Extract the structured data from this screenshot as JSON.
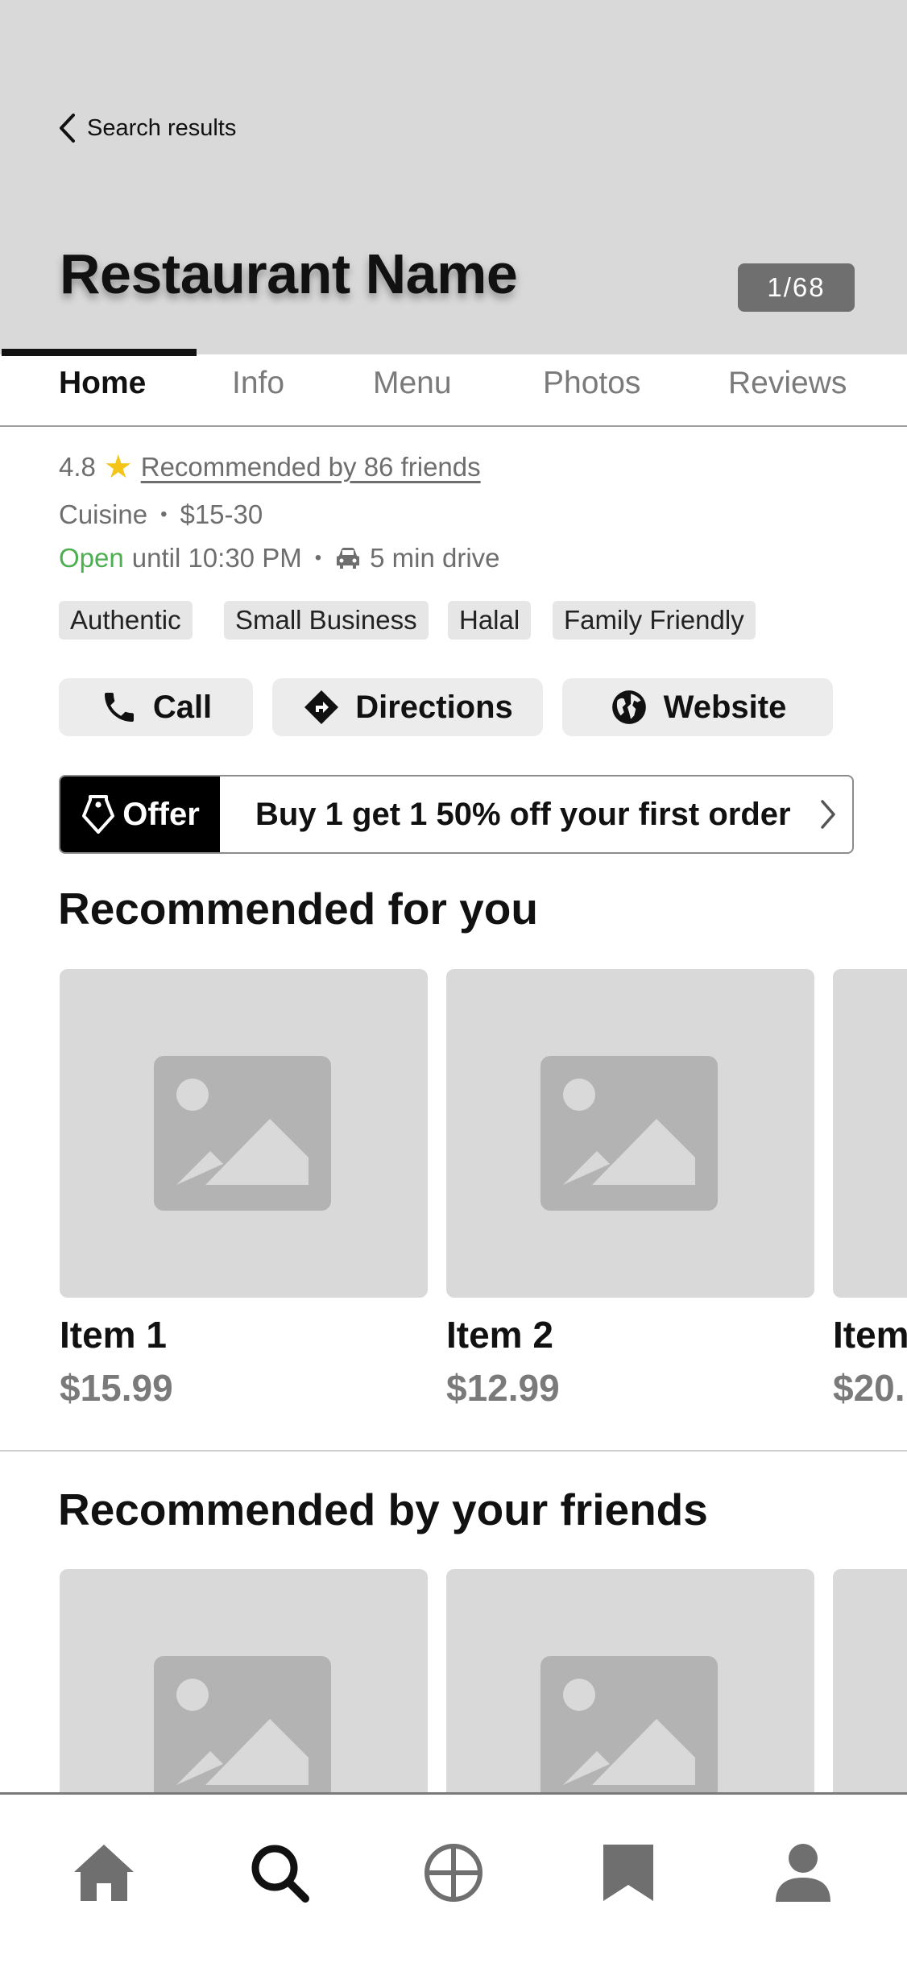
{
  "header": {
    "back_label": "Search results",
    "title": "Restaurant Name",
    "photo_counter": "1/68"
  },
  "tabs": [
    {
      "label": "Home",
      "active": true
    },
    {
      "label": "Info",
      "active": false
    },
    {
      "label": "Menu",
      "active": false
    },
    {
      "label": "Photos",
      "active": false
    },
    {
      "label": "Reviews",
      "active": false
    }
  ],
  "summary": {
    "rating": "4.8",
    "friends_text": "Recommended by 86 friends",
    "cuisine": "Cuisine",
    "price_range": "$15-30",
    "open_status": "Open",
    "hours": "until 10:30 PM",
    "drive_time": "5 min drive"
  },
  "tags": [
    "Authentic",
    "Small Business",
    "Halal",
    "Family Friendly"
  ],
  "actions": {
    "call": "Call",
    "directions": "Directions",
    "website": "Website"
  },
  "offer": {
    "badge": "Offer",
    "text": "Buy 1 get 1 50% off your first order"
  },
  "recommended_for_you": {
    "title": "Recommended for you",
    "items": [
      {
        "name": "Item 1",
        "price": "$15.99"
      },
      {
        "name": "Item 2",
        "price": "$12.99"
      },
      {
        "name": "Item",
        "price": "$20."
      }
    ]
  },
  "recommended_by_friends": {
    "title": "Recommended by your friends"
  },
  "colors": {
    "open_green": "#4caf50",
    "star_yellow": "#f4c518",
    "placeholder_gray": "#d9d9d9"
  },
  "bottom_nav": [
    "home-icon",
    "search-icon",
    "explore-icon",
    "bookmark-icon",
    "profile-icon"
  ]
}
